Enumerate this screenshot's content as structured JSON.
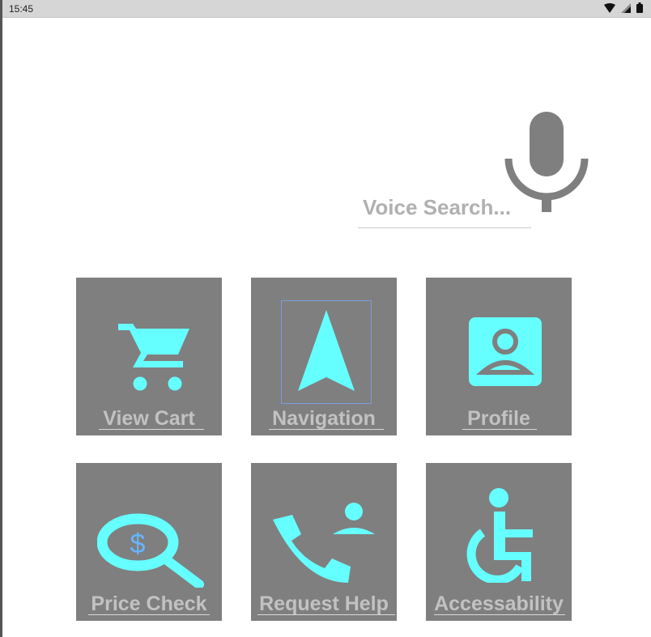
{
  "status_bar": {
    "time": "15:45",
    "icons": [
      "wifi-icon",
      "signal-icon",
      "battery-icon"
    ]
  },
  "search": {
    "placeholder": "Voice Search...",
    "mic_icon": "microphone-icon"
  },
  "colors": {
    "tile_background": "#7f7f7f",
    "icon_accent": "#66ffff",
    "label_text": "#c2c2c2",
    "mic": "#7f7f7f"
  },
  "tiles": [
    {
      "label": "View Cart",
      "icon": "cart-icon"
    },
    {
      "label": "Navigation",
      "icon": "navigation-arrow-icon"
    },
    {
      "label": "Profile",
      "icon": "profile-icon"
    },
    {
      "label": "Price Check",
      "icon": "price-search-icon"
    },
    {
      "label": "Request Help",
      "icon": "phone-help-icon"
    },
    {
      "label": "Accessability",
      "icon": "wheelchair-icon"
    }
  ]
}
